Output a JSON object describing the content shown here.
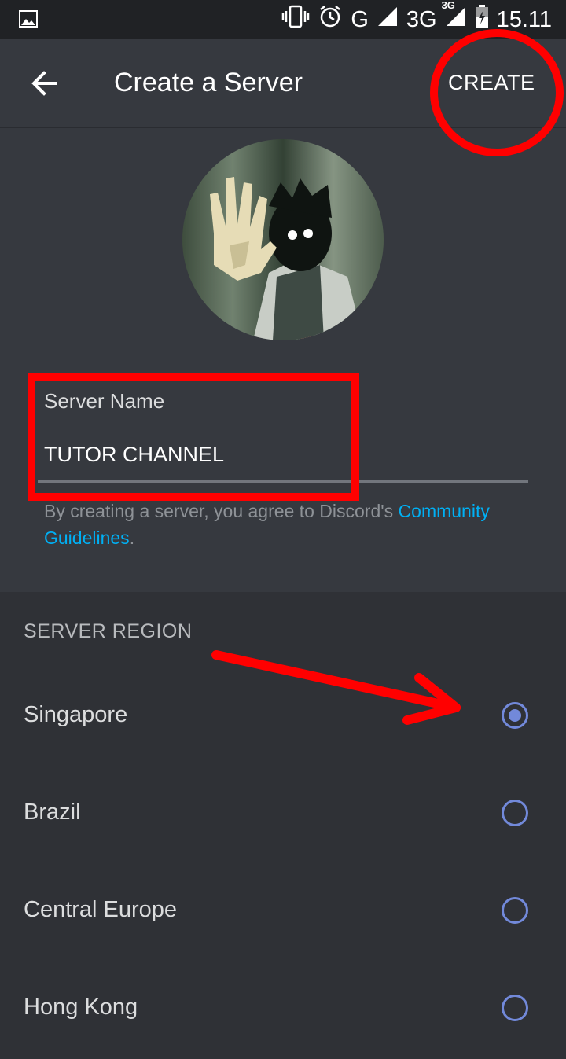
{
  "status_bar": {
    "icons": [
      "image-icon",
      "vibrate-icon",
      "alarm-icon",
      "signal-icon",
      "battery-charging-icon"
    ],
    "network_g": "G",
    "network_3g": "3G",
    "network_3g_super": "3G",
    "time": "15.11"
  },
  "header": {
    "back_icon": "arrow-left-icon",
    "title": "Create a Server",
    "create_label": "CREATE"
  },
  "server_form": {
    "name_label": "Server Name",
    "name_value": "TUTOR CHANNEL",
    "agree_prefix": "By creating a server, you agree to Discord's ",
    "agree_link": "Community Guidelines",
    "agree_suffix": "."
  },
  "region": {
    "header": "SERVER REGION",
    "options": [
      {
        "name": "Singapore",
        "selected": true
      },
      {
        "name": "Brazil",
        "selected": false
      },
      {
        "name": "Central Europe",
        "selected": false
      },
      {
        "name": "Hong Kong",
        "selected": false
      }
    ]
  },
  "colors": {
    "accent": "#7289da",
    "link": "#00b0f4",
    "annotation": "#ff0000",
    "background": "#2f3136",
    "surface": "#36393f"
  }
}
